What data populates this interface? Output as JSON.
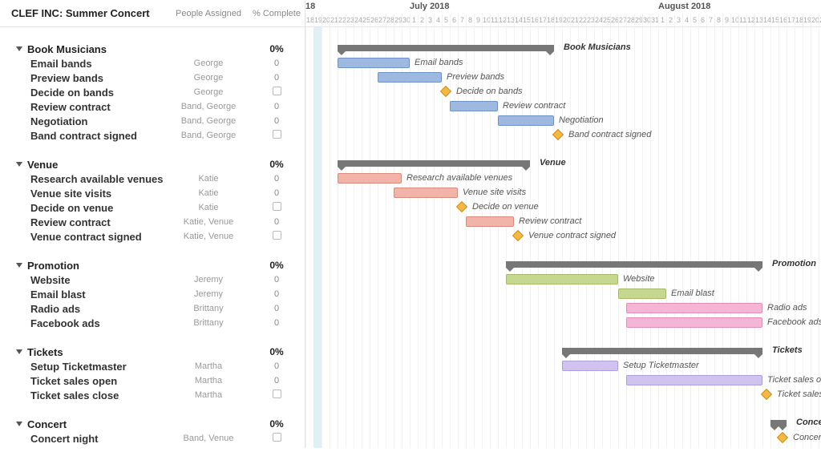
{
  "chart_data": {
    "type": "gantt",
    "title": "CLEF INC: Summer Concert",
    "columns": [
      "People Assigned",
      "% Complete"
    ],
    "timeline": {
      "start": "2018-06-18",
      "end": "2018-08-22",
      "months": [
        {
          "label": "18",
          "left_day": 0
        },
        {
          "label": "July 2018",
          "left_day": 13
        },
        {
          "label": "August 2018",
          "left_day": 44
        }
      ],
      "today_day": 1
    },
    "day_width": 10,
    "groups": [
      {
        "name": "Book Musicians",
        "pct": "0%",
        "summary": {
          "start": 4,
          "end": 31
        },
        "tasks": [
          {
            "name": "Email bands",
            "people": "George",
            "pct": "0",
            "start": 4,
            "end": 13,
            "color": "blue"
          },
          {
            "name": "Preview bands",
            "people": "George",
            "pct": "0",
            "start": 9,
            "end": 17,
            "color": "blue"
          },
          {
            "name": "Decide on bands",
            "people": "George",
            "pct": "box",
            "milestone": 17
          },
          {
            "name": "Review contract",
            "people": "Band, George",
            "pct": "0",
            "start": 18,
            "end": 24,
            "color": "blue"
          },
          {
            "name": "Negotiation",
            "people": "Band, George",
            "pct": "0",
            "start": 24,
            "end": 31,
            "color": "blue"
          },
          {
            "name": "Band contract signed",
            "people": "Band, George",
            "pct": "box",
            "milestone": 31
          }
        ]
      },
      {
        "name": "Venue",
        "pct": "0%",
        "summary": {
          "start": 4,
          "end": 28
        },
        "tasks": [
          {
            "name": "Research available venues",
            "people": "Katie",
            "pct": "0",
            "start": 4,
            "end": 12,
            "color": "red"
          },
          {
            "name": "Venue site visits",
            "people": "Katie",
            "pct": "0",
            "start": 11,
            "end": 19,
            "color": "red"
          },
          {
            "name": "Decide on venue",
            "people": "Katie",
            "pct": "box",
            "milestone": 19
          },
          {
            "name": "Review contract",
            "people": "Katie, Venue",
            "pct": "0",
            "start": 20,
            "end": 26,
            "color": "red"
          },
          {
            "name": "Venue contract signed",
            "people": "Katie, Venue",
            "pct": "box",
            "milestone": 26
          }
        ]
      },
      {
        "name": "Promotion",
        "pct": "0%",
        "summary": {
          "start": 25,
          "end": 57,
          "label_right": true
        },
        "tasks": [
          {
            "name": "Website",
            "people": "Jeremy",
            "pct": "0",
            "start": 25,
            "end": 39,
            "color": "green"
          },
          {
            "name": "Email blast",
            "people": "Jeremy",
            "pct": "0",
            "start": 39,
            "end": 45,
            "color": "green"
          },
          {
            "name": "Radio ads",
            "people": "Brittany",
            "pct": "0",
            "start": 40,
            "end": 57,
            "color": "pink",
            "label_right": true
          },
          {
            "name": "Facebook ads",
            "people": "Brittany",
            "pct": "0",
            "start": 40,
            "end": 57,
            "color": "pink",
            "label_right": true
          }
        ]
      },
      {
        "name": "Tickets",
        "pct": "0%",
        "summary": {
          "start": 32,
          "end": 57,
          "label_right": true
        },
        "tasks": [
          {
            "name": "Setup Ticketmaster",
            "people": "Martha",
            "pct": "0",
            "start": 32,
            "end": 39,
            "color": "purple"
          },
          {
            "name": "Ticket sales open",
            "people": "Martha",
            "pct": "0",
            "start": 40,
            "end": 57,
            "color": "purple",
            "label_right": true
          },
          {
            "name": "Ticket sales close",
            "people": "Martha",
            "pct": "box",
            "milestone": 57,
            "label_right": true
          }
        ]
      },
      {
        "name": "Concert",
        "pct": "0%",
        "summary": {
          "start": 58,
          "end": 60,
          "label_right": true
        },
        "tasks": [
          {
            "name": "Concert night",
            "people": "Band, Venue",
            "pct": "box",
            "milestone": 59,
            "label_right": true
          }
        ]
      }
    ]
  }
}
